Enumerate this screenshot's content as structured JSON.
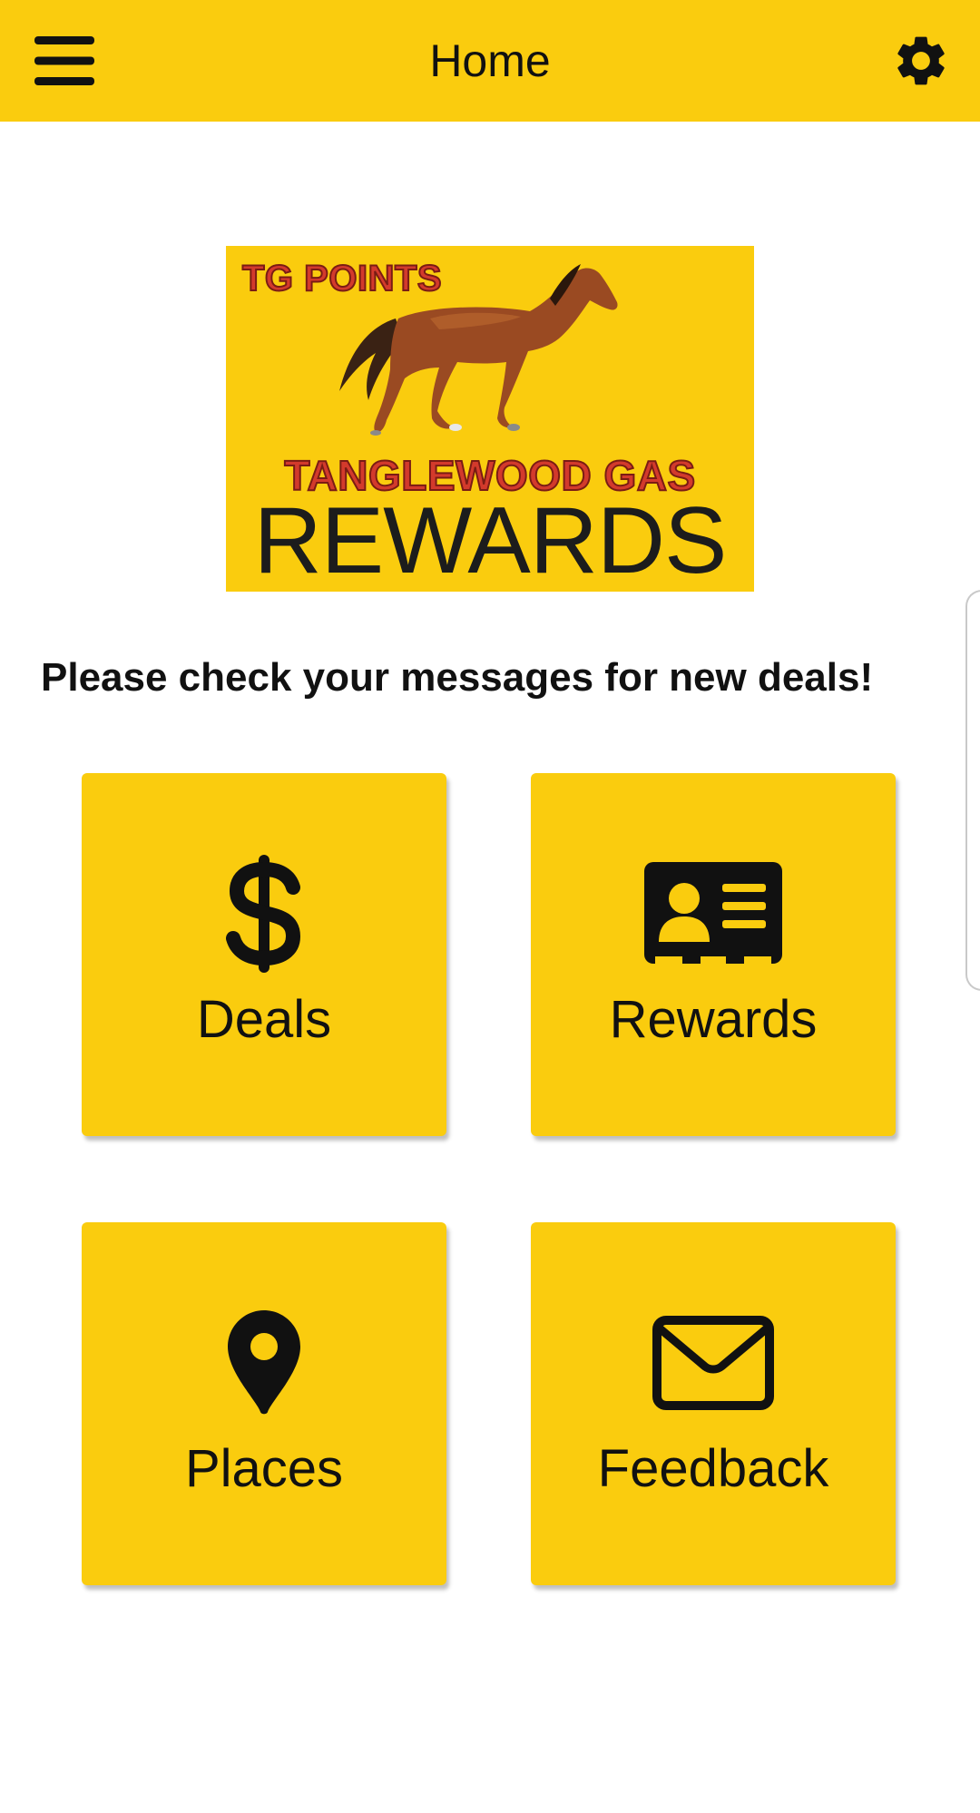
{
  "appbar": {
    "title": "Home",
    "menu_icon": "hamburger-menu-icon",
    "settings_icon": "gear-icon",
    "background_color": "#FACC0E"
  },
  "logo": {
    "top_text": "TG POINTS",
    "middle_text": "TANGLEWOOD GAS",
    "bottom_text": "REWARDS",
    "text_color_red": "#D33A2C",
    "background_color": "#FACC0E"
  },
  "message": "Please check your messages for new deals!",
  "tiles": [
    {
      "label": "Deals",
      "icon": "dollar-sign-icon"
    },
    {
      "label": "Rewards",
      "icon": "id-card-icon"
    },
    {
      "label": "Places",
      "icon": "map-pin-icon"
    },
    {
      "label": "Feedback",
      "icon": "envelope-icon"
    }
  ],
  "accent_color": "#FACC0E"
}
